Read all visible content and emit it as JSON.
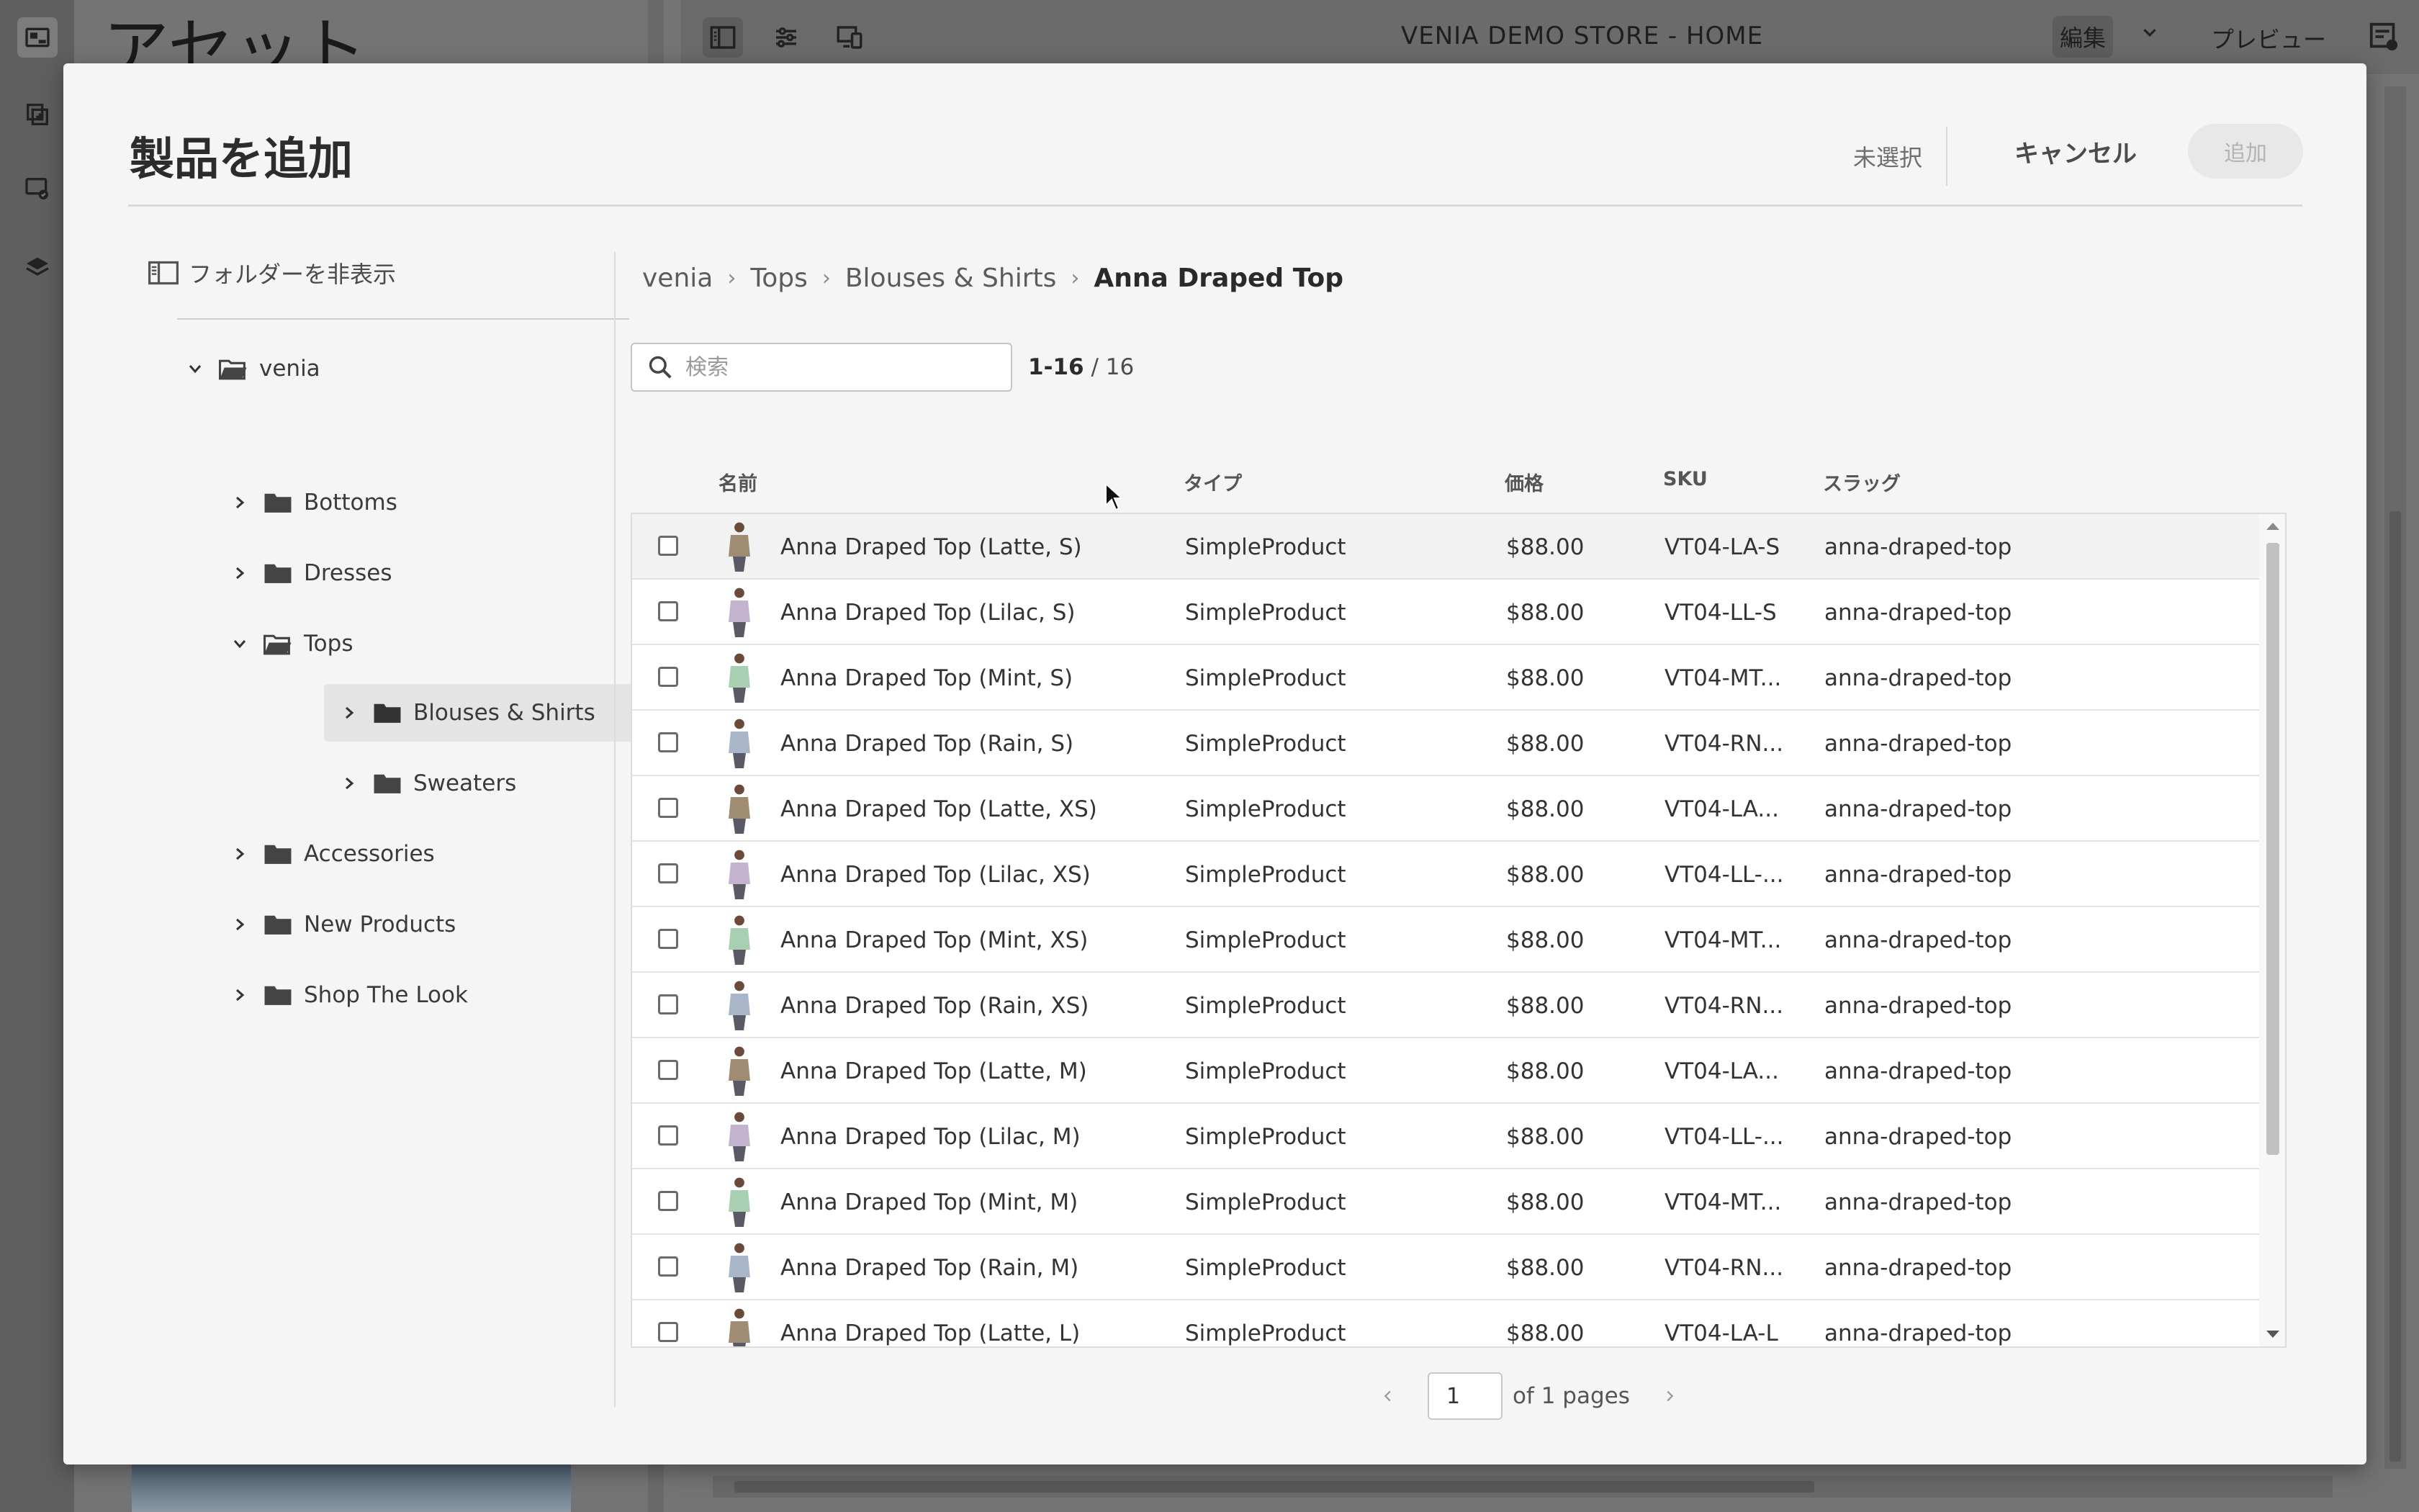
{
  "background": {
    "asset_panel_title": "アセット",
    "editor_title": "VENIA DEMO STORE - HOME",
    "edit_label": "編集",
    "preview_label": "プレビュー"
  },
  "dialog": {
    "title": "製品を追加",
    "selection_status": "未選択",
    "cancel_label": "キャンセル",
    "add_label": "追加",
    "hide_folders_label": "フォルダーを非表示",
    "tree": [
      {
        "label": "venia",
        "expanded": true
      },
      {
        "label": "Bottoms",
        "expanded": false
      },
      {
        "label": "Dresses",
        "expanded": false
      },
      {
        "label": "Tops",
        "expanded": true
      },
      {
        "label": "Blouses & Shirts",
        "expanded": false,
        "selected": true
      },
      {
        "label": "Sweaters",
        "expanded": false
      },
      {
        "label": "Accessories",
        "expanded": false
      },
      {
        "label": "New Products",
        "expanded": false
      },
      {
        "label": "Shop The Look",
        "expanded": false
      }
    ],
    "breadcrumb": [
      "venia",
      "Tops",
      "Blouses & Shirts",
      "Anna Draped Top"
    ],
    "search": {
      "placeholder": "検索",
      "value": ""
    },
    "count": {
      "range": "1-16",
      "total": "/ 16"
    },
    "columns": {
      "name": "名前",
      "type": "タイプ",
      "price": "価格",
      "sku": "SKU",
      "slug": "スラッグ"
    },
    "rows": [
      {
        "name": "Anna Draped Top (Latte, S)",
        "type": "SimpleProduct",
        "price": "$88.00",
        "sku": "VT04-LA-S",
        "slug": "anna-draped-top",
        "color": "#a08c72"
      },
      {
        "name": "Anna Draped Top (Lilac, S)",
        "type": "SimpleProduct",
        "price": "$88.00",
        "sku": "VT04-LL-S",
        "slug": "anna-draped-top",
        "color": "#c4b3cf"
      },
      {
        "name": "Anna Draped Top (Mint, S)",
        "type": "SimpleProduct",
        "price": "$88.00",
        "sku": "VT04-MT...",
        "slug": "anna-draped-top",
        "color": "#a9cfb3"
      },
      {
        "name": "Anna Draped Top (Rain, S)",
        "type": "SimpleProduct",
        "price": "$88.00",
        "sku": "VT04-RN...",
        "slug": "anna-draped-top",
        "color": "#a9b6c9"
      },
      {
        "name": "Anna Draped Top (Latte, XS)",
        "type": "SimpleProduct",
        "price": "$88.00",
        "sku": "VT04-LA...",
        "slug": "anna-draped-top",
        "color": "#a08c72"
      },
      {
        "name": "Anna Draped Top (Lilac, XS)",
        "type": "SimpleProduct",
        "price": "$88.00",
        "sku": "VT04-LL-...",
        "slug": "anna-draped-top",
        "color": "#c4b3cf"
      },
      {
        "name": "Anna Draped Top (Mint, XS)",
        "type": "SimpleProduct",
        "price": "$88.00",
        "sku": "VT04-MT...",
        "slug": "anna-draped-top",
        "color": "#a9cfb3"
      },
      {
        "name": "Anna Draped Top (Rain, XS)",
        "type": "SimpleProduct",
        "price": "$88.00",
        "sku": "VT04-RN...",
        "slug": "anna-draped-top",
        "color": "#a9b6c9"
      },
      {
        "name": "Anna Draped Top (Latte, M)",
        "type": "SimpleProduct",
        "price": "$88.00",
        "sku": "VT04-LA...",
        "slug": "anna-draped-top",
        "color": "#a08c72"
      },
      {
        "name": "Anna Draped Top (Lilac, M)",
        "type": "SimpleProduct",
        "price": "$88.00",
        "sku": "VT04-LL-...",
        "slug": "anna-draped-top",
        "color": "#c4b3cf"
      },
      {
        "name": "Anna Draped Top (Mint, M)",
        "type": "SimpleProduct",
        "price": "$88.00",
        "sku": "VT04-MT...",
        "slug": "anna-draped-top",
        "color": "#a9cfb3"
      },
      {
        "name": "Anna Draped Top (Rain, M)",
        "type": "SimpleProduct",
        "price": "$88.00",
        "sku": "VT04-RN...",
        "slug": "anna-draped-top",
        "color": "#a9b6c9"
      },
      {
        "name": "Anna Draped Top (Latte, L)",
        "type": "SimpleProduct",
        "price": "$88.00",
        "sku": "VT04-LA-L",
        "slug": "anna-draped-top",
        "color": "#a08c72"
      }
    ],
    "pager": {
      "page": "1",
      "of_label": "of 1 pages"
    }
  }
}
